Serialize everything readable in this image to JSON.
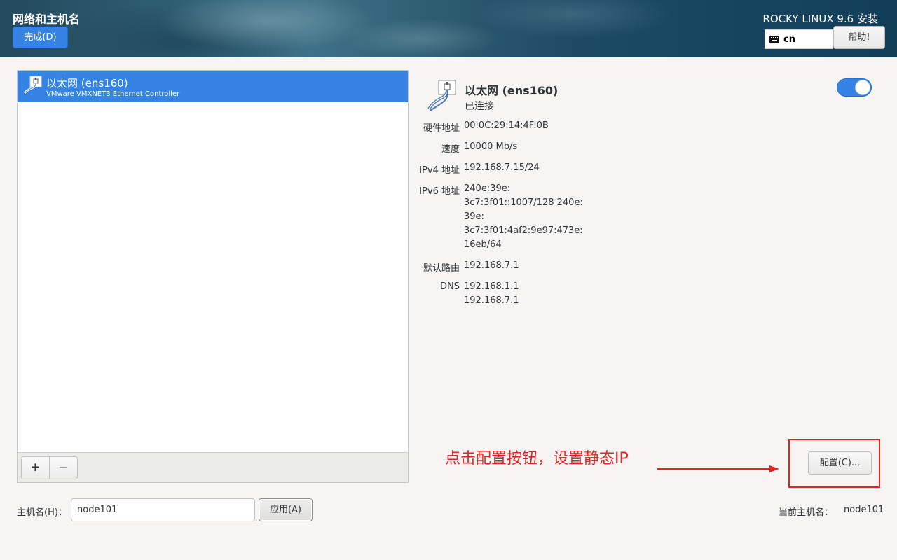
{
  "header": {
    "page_title": "网络和主机名",
    "done_label": "完成(D)",
    "product_title": "ROCKY LINUX 9.6 安装",
    "keyboard_layout": "cn",
    "help_label": "帮助!"
  },
  "devices": {
    "items": [
      {
        "name": "以太网 (ens160)",
        "description": "VMware VMXNET3 Ethernet Controller",
        "selected": true
      }
    ],
    "add_label": "+",
    "remove_label": "−"
  },
  "details": {
    "name": "以太网 (ens160)",
    "status": "已连接",
    "enabled": true,
    "properties": [
      {
        "label": "硬件地址",
        "lines": [
          "00:0C:29:14:4F:0B"
        ]
      },
      {
        "label": "速度",
        "lines": [
          "10000 Mb/s"
        ]
      },
      {
        "label": "IPv4 地址",
        "lines": [
          "192.168.7.15/24"
        ]
      },
      {
        "label": "IPv6 地址",
        "lines": [
          "240e:39e:",
          "3c7:3f01::1007/128 240e:",
          "39e:",
          "3c7:3f01:4af2:9e97:473e:",
          "16eb/64"
        ]
      },
      {
        "label": "默认路由",
        "lines": [
          "192.168.7.1"
        ]
      },
      {
        "label": "DNS",
        "lines": [
          "192.168.1.1",
          "192.168.7.1"
        ]
      }
    ],
    "configure_label": "配置(C)..."
  },
  "annotation": {
    "text": "点击配置按钮，设置静态IP",
    "color": "#e4251f"
  },
  "hostname": {
    "label": "主机名(H)：",
    "value": "node101",
    "apply_label": "应用(A)",
    "current_label": "当前主机名：",
    "current_value": "node101"
  },
  "colors": {
    "accent": "#3584e4"
  }
}
